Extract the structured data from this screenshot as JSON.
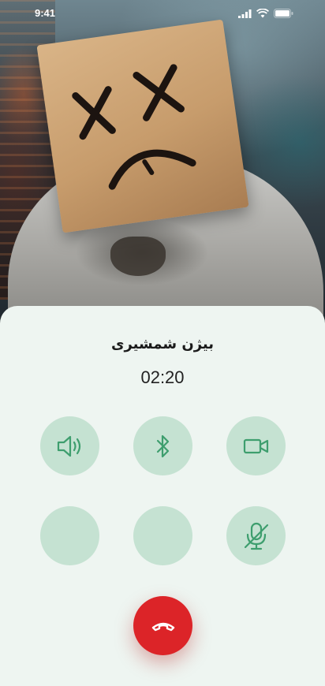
{
  "status_bar": {
    "time": "9:41"
  },
  "call": {
    "caller_name": "بیژن شمشیری",
    "duration": "02:20"
  },
  "controls": {
    "row1": [
      "speaker-icon",
      "bluetooth-icon",
      "video-camera-icon"
    ],
    "row2": [
      "empty-slot",
      "empty-slot",
      "mic-muted-icon"
    ],
    "end": "phone-hangup-icon"
  },
  "colors": {
    "accent": "#3e9e6e",
    "button_bg": "#c5e2d2",
    "sheet_bg": "#eef5f1",
    "end_call": "#dc2428"
  }
}
